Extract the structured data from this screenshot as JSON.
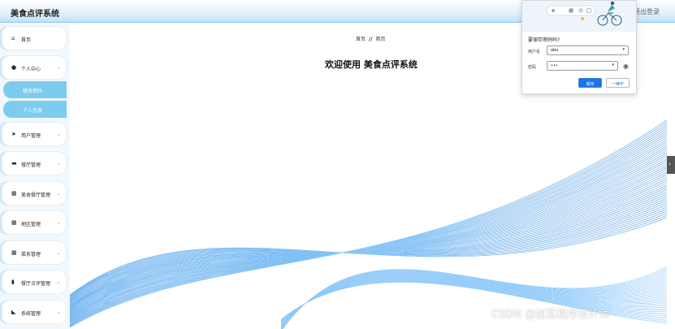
{
  "header": {
    "app_title": "美食点评系统",
    "logout_label": "退出登录"
  },
  "sidebar": {
    "items": [
      {
        "label": "首页",
        "icon": "home-icon",
        "glyph": "⌂",
        "has_chevron": false
      },
      {
        "label": "个人中心",
        "icon": "user-icon",
        "glyph": "●",
        "has_chevron": true
      },
      {
        "label": "用户管理",
        "icon": "send-icon",
        "glyph": "➤",
        "has_chevron": true
      },
      {
        "label": "餐厅管理",
        "icon": "message-icon",
        "glyph": "▬",
        "has_chevron": true
      },
      {
        "label": "美食餐厅管理",
        "icon": "grid-icon",
        "glyph": "▦",
        "has_chevron": true
      },
      {
        "label": "地区管理",
        "icon": "grid-icon",
        "glyph": "▦",
        "has_chevron": true
      },
      {
        "label": "菜系管理",
        "icon": "grid-icon",
        "glyph": "▦",
        "has_chevron": true
      },
      {
        "label": "餐厅点评管理",
        "icon": "chart-icon",
        "glyph": "▮",
        "has_chevron": true
      },
      {
        "label": "系统管理",
        "icon": "truck-icon",
        "glyph": "◣",
        "has_chevron": true
      }
    ],
    "submenu": [
      {
        "label": "修改密码"
      },
      {
        "label": "个人信息"
      }
    ]
  },
  "main": {
    "breadcrumb": [
      "首页",
      "//",
      "首页"
    ],
    "welcome": "欢迎使用 美食点评系统"
  },
  "password_popup": {
    "title": "要保存密码吗?",
    "username_label": "用户名",
    "username_value": "abo",
    "password_label": "密码",
    "password_value": "•••",
    "save_label": "保存",
    "never_label": "一律不"
  },
  "watermark": "CSDN @加瓦程序设计师",
  "colors": {
    "accent": "#7ecbf0",
    "wave": "#2196f3",
    "save_button": "#1a73e8"
  }
}
